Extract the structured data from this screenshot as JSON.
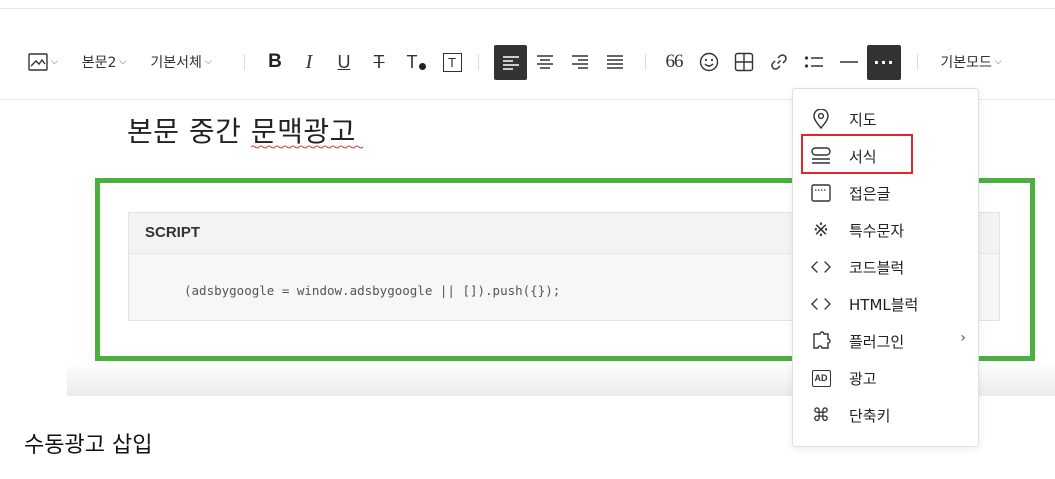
{
  "toolbar": {
    "image_icon": "image-icon",
    "paragraph_style": "본문2",
    "font_family": "기본서체",
    "bold": "B",
    "italic": "I",
    "underline": "U",
    "strike": "T",
    "text_color": "T",
    "text_bg": "T",
    "quote": "66",
    "mode": "기본모드",
    "more": "···",
    "active_color": "#333333"
  },
  "editor": {
    "heading": "본문 중간 문맥광고",
    "code_title": "SCRIPT",
    "code_line": "(adsbygoogle = window.adsbygoogle || []).push({});",
    "manual_heading": "수동광고 삽입",
    "ad_border_color": "#4caf3f"
  },
  "menu": {
    "items": [
      {
        "label": "지도",
        "icon": "map-pin-icon"
      },
      {
        "label": "서식",
        "icon": "template-icon"
      },
      {
        "label": "접은글",
        "icon": "fold-icon"
      },
      {
        "label": "특수문자",
        "icon": "special-char-icon"
      },
      {
        "label": "코드블럭",
        "icon": "code-icon"
      },
      {
        "label": "HTML블럭",
        "icon": "html-code-icon"
      },
      {
        "label": "플러그인",
        "icon": "plugin-icon"
      },
      {
        "label": "광고",
        "icon": "ad-icon"
      },
      {
        "label": "단축키",
        "icon": "shortcut-icon"
      }
    ],
    "plugin_arrow": "›",
    "ad_badge": "AD",
    "shortcut_glyph": "⌘",
    "special_glyph": "※",
    "highlight_color": "#e0282b"
  }
}
